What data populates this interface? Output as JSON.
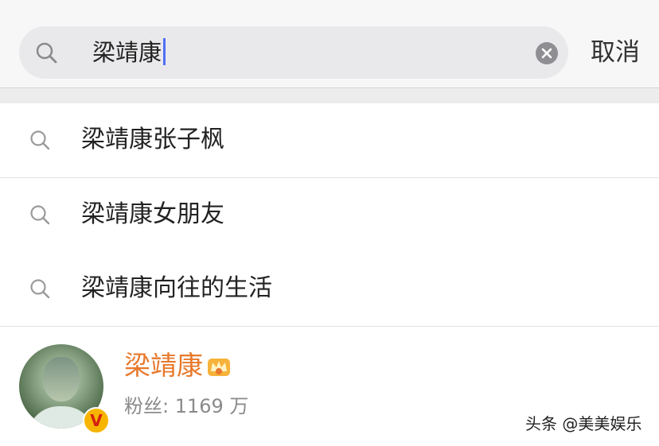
{
  "search": {
    "query": "梁靖康",
    "cancel_label": "取消",
    "icons": {
      "search": "search-icon",
      "clear": "clear-icon"
    }
  },
  "suggestions": [
    {
      "text": "梁靖康张子枫",
      "icon": "search-icon"
    },
    {
      "text": "梁靖康女朋友",
      "icon": "search-icon"
    },
    {
      "text": "梁靖康向往的生活",
      "icon": "search-icon"
    }
  ],
  "user_result": {
    "name": "梁靖康",
    "fans": "粉丝: 1169 万",
    "verified_mark": "V",
    "badge_icon": "crown-icon",
    "name_color": "#e8782a"
  },
  "watermark": "头条 @美美娱乐",
  "colors": {
    "caret": "#4f6ff5",
    "verified_bg": "#f7b500",
    "search_box_bg": "#e9e9eb"
  }
}
